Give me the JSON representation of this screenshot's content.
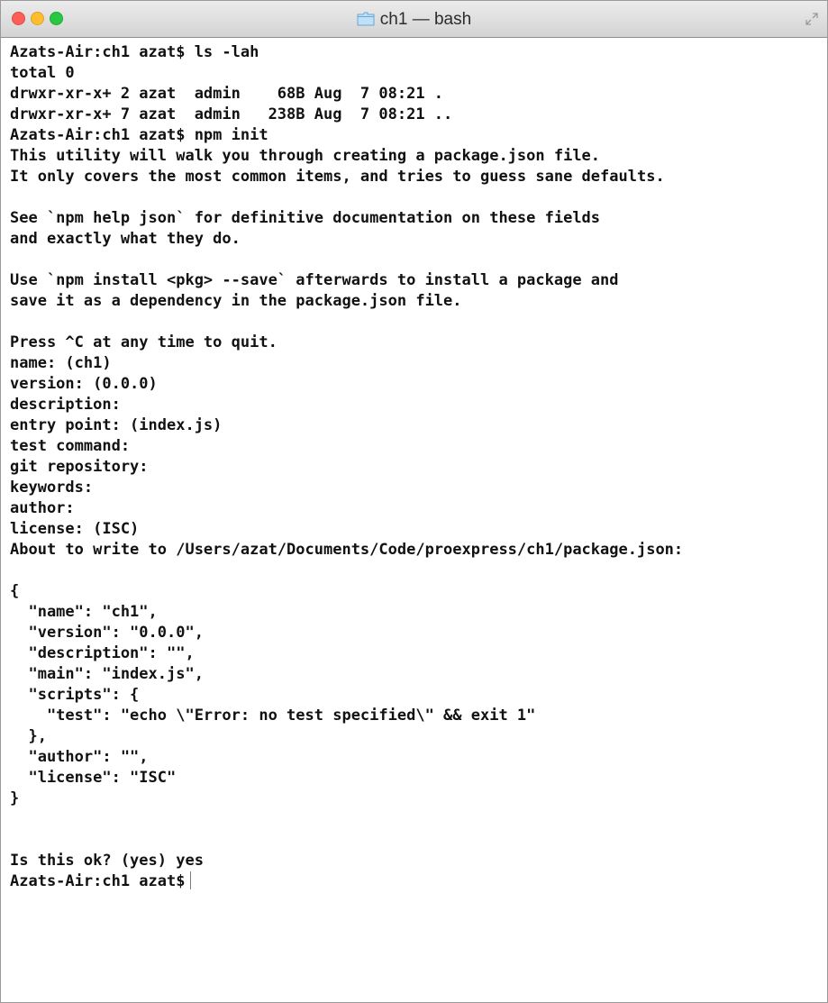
{
  "window": {
    "title": "ch1 — bash"
  },
  "icons": {
    "title": "folder-icon",
    "fullscreen": "fullscreen-arrows-icon",
    "traffic_lights": [
      "close",
      "minimize",
      "zoom"
    ]
  },
  "colors": {
    "close": "#fc5f57",
    "minimize": "#fdbd2e",
    "zoom": "#28c940",
    "text": "#111111",
    "background": "#ffffff"
  },
  "terminal": {
    "lines": [
      "Azats-Air:ch1 azat$ ls -lah",
      "total 0",
      "drwxr-xr-x+ 2 azat  admin    68B Aug  7 08:21 .",
      "drwxr-xr-x+ 7 azat  admin   238B Aug  7 08:21 ..",
      "Azats-Air:ch1 azat$ npm init",
      "This utility will walk you through creating a package.json file.",
      "It only covers the most common items, and tries to guess sane defaults.",
      "",
      "See `npm help json` for definitive documentation on these fields",
      "and exactly what they do.",
      "",
      "Use `npm install <pkg> --save` afterwards to install a package and",
      "save it as a dependency in the package.json file.",
      "",
      "Press ^C at any time to quit.",
      "name: (ch1)",
      "version: (0.0.0)",
      "description:",
      "entry point: (index.js)",
      "test command:",
      "git repository:",
      "keywords:",
      "author:",
      "license: (ISC)",
      "About to write to /Users/azat/Documents/Code/proexpress/ch1/package.json:",
      "",
      "{",
      "  \"name\": \"ch1\",",
      "  \"version\": \"0.0.0\",",
      "  \"description\": \"\",",
      "  \"main\": \"index.js\",",
      "  \"scripts\": {",
      "    \"test\": \"echo \\\"Error: no test specified\\\" && exit 1\"",
      "  },",
      "  \"author\": \"\",",
      "  \"license\": \"ISC\"",
      "}",
      "",
      "",
      "Is this ok? (yes) yes"
    ],
    "prompt": "Azats-Air:ch1 azat$"
  }
}
